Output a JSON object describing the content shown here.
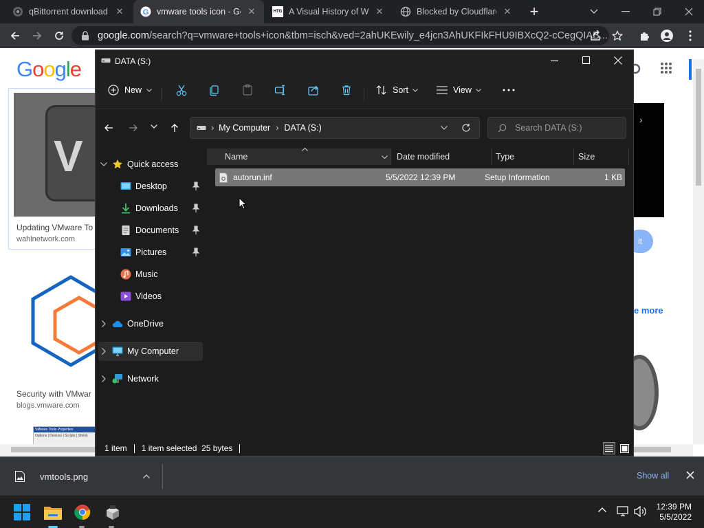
{
  "browser": {
    "tabs": [
      {
        "label": "qBittorrent download l",
        "active": false
      },
      {
        "label": "vmware tools icon - Go",
        "active": true
      },
      {
        "label": "A Visual History of Wi",
        "active": false
      },
      {
        "label": "Blocked by Cloudflare",
        "active": false
      }
    ],
    "tab_favicon_text": "HTG",
    "url_host": "google.com",
    "url_path": "/search?q=vmware+tools+icon&tbm=isch&ved=2ahUKEwily_e4jcn3AhUKFIkFHU9IBXcQ2-cCegQIAB..."
  },
  "google": {
    "logo_letters": [
      "G",
      "o",
      "o",
      "g",
      "l",
      "e"
    ],
    "logo_colors": [
      "#4285f4",
      "#ea4335",
      "#fbbc05",
      "#4285f4",
      "#34a853",
      "#ea4335"
    ],
    "results": [
      {
        "title": "Updating VMware To",
        "source": "wahlnetwork.com"
      },
      {
        "title": "Security with VMwar",
        "source": "blogs.vmware.com"
      }
    ],
    "side_text_more": "e more",
    "side_button_text": "it",
    "thumb_text": "VMware Tools Properties",
    "thumb_tabs": "Options | Devices | Scripts | Shrink"
  },
  "explorer": {
    "title": "DATA (S:)",
    "toolbar": {
      "new_label": "New",
      "sort_label": "Sort",
      "view_label": "View"
    },
    "breadcrumb": [
      "My Computer",
      "DATA (S:)"
    ],
    "search_placeholder": "Search DATA (S:)",
    "nav": {
      "quick_access": "Quick access",
      "desktop": "Desktop",
      "downloads": "Downloads",
      "documents": "Documents",
      "pictures": "Pictures",
      "music": "Music",
      "videos": "Videos",
      "onedrive": "OneDrive",
      "my_computer": "My Computer",
      "network": "Network"
    },
    "columns": {
      "name": "Name",
      "date": "Date modified",
      "type": "Type",
      "size": "Size"
    },
    "files": [
      {
        "name": "autorun.inf",
        "date": "5/5/2022 12:39 PM",
        "type": "Setup Information",
        "size": "1 KB"
      }
    ],
    "status": {
      "count": "1 item",
      "selected": "1 item selected  25 bytes"
    }
  },
  "download_bar": {
    "file": "vmtools.png",
    "show_all": "Show all"
  },
  "taskbar": {
    "time": "12:39 PM",
    "date": "5/5/2022"
  }
}
